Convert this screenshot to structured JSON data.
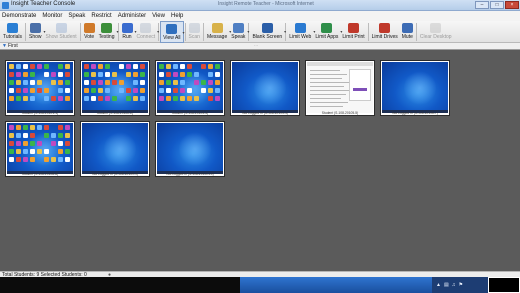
{
  "window": {
    "title": "Insight Teacher Console",
    "caption": "Insight Remote Teacher - Microsoft Internet",
    "buttons": [
      "–",
      "□",
      "×"
    ]
  },
  "menu": [
    "Demonstrate",
    "Monitor",
    "Speak",
    "Restrict",
    "Administer",
    "View",
    "Help"
  ],
  "toolbar": [
    {
      "label": "Tutorials",
      "icon": "globe-icon",
      "color": "#2a7fd4",
      "state": "normal",
      "dropdown": false
    },
    {
      "label": "Show",
      "icon": "monitor-icon",
      "color": "#4a6fa8",
      "state": "normal",
      "dropdown": true
    },
    {
      "label": "Show Student",
      "icon": "student-screen-icon",
      "color": "#7a9ac8",
      "state": "disabled",
      "dropdown": false
    },
    {
      "label": "Vote",
      "icon": "vote-icon",
      "color": "#d07a2a",
      "state": "normal",
      "dropdown": false
    },
    {
      "label": "Testing",
      "icon": "test-icon",
      "color": "#3c8f3a",
      "state": "normal",
      "dropdown": true
    },
    {
      "label": "Run",
      "icon": "run-icon",
      "color": "#3a6ccf",
      "state": "normal",
      "dropdown": true
    },
    {
      "label": "Connect",
      "icon": "connect-icon",
      "color": "#9aa9bd",
      "state": "disabled",
      "dropdown": true
    },
    {
      "label": "View All",
      "icon": "view-all-icon",
      "color": "#2f6fbe",
      "state": "active",
      "dropdown": true
    },
    {
      "label": "Scan",
      "icon": "scan-icon",
      "color": "#9aa9bd",
      "state": "disabled",
      "dropdown": false
    },
    {
      "label": "Message",
      "icon": "message-icon",
      "color": "#d8b24a",
      "state": "normal",
      "dropdown": true
    },
    {
      "label": "Speak",
      "icon": "speak-icon",
      "color": "#4f7fc3",
      "state": "normal",
      "dropdown": true
    },
    {
      "label": "Blank Screen",
      "icon": "blank-screen-icon",
      "color": "#2b5fa8",
      "state": "normal",
      "dropdown": true
    },
    {
      "label": "Limit Web",
      "icon": "limit-web-icon",
      "color": "#2a7ad1",
      "state": "normal",
      "dropdown": true
    },
    {
      "label": "Limit Apps",
      "icon": "limit-apps-icon",
      "color": "#2f8f4a",
      "state": "normal",
      "dropdown": true
    },
    {
      "label": "Limit Print",
      "icon": "limit-print-icon",
      "color": "#c0392b",
      "state": "normal",
      "dropdown": false
    },
    {
      "label": "Limit Drives",
      "icon": "limit-drives-icon",
      "color": "#c0392b",
      "state": "normal",
      "dropdown": false
    },
    {
      "label": "Mute",
      "icon": "mute-icon",
      "color": "#3d6cb5",
      "state": "normal",
      "dropdown": false
    },
    {
      "label": "Clear Desktop",
      "icon": "clear-desktop-icon",
      "color": "#b0b0b0",
      "state": "disabled",
      "dropdown": false
    }
  ],
  "filter": {
    "label": "First",
    "badge": "···"
  },
  "thumbnails": [
    {
      "caption": "Student (S-108-20101-1)",
      "screen": "desktop"
    },
    {
      "caption": "Student (S-108-20102-2)",
      "screen": "desktop"
    },
    {
      "caption": "Student (S-108-20103-3)",
      "screen": "desktop"
    },
    {
      "caption": "Not Logged In (S-108-20104-4)",
      "screen": "blank"
    },
    {
      "caption": "Student (S-108-20105-5)",
      "screen": "document"
    },
    {
      "caption": "Not Logged In (S-108-20106-7)",
      "screen": "blank"
    },
    {
      "caption": "Student (S-108-20108-8)",
      "screen": "desktop"
    },
    {
      "caption": "Not Logged In (S-108-20109-9)",
      "screen": "blank"
    },
    {
      "caption": "Not Logged In (S-108-20110-10)",
      "screen": "blank"
    }
  ],
  "status": {
    "text": "Total Students: 9  Selected Students: 0",
    "icon": "lock-icon"
  },
  "tray": {
    "icons": [
      "arrow-up-icon",
      "network-icon",
      "volume-icon",
      "flag-icon"
    ]
  }
}
